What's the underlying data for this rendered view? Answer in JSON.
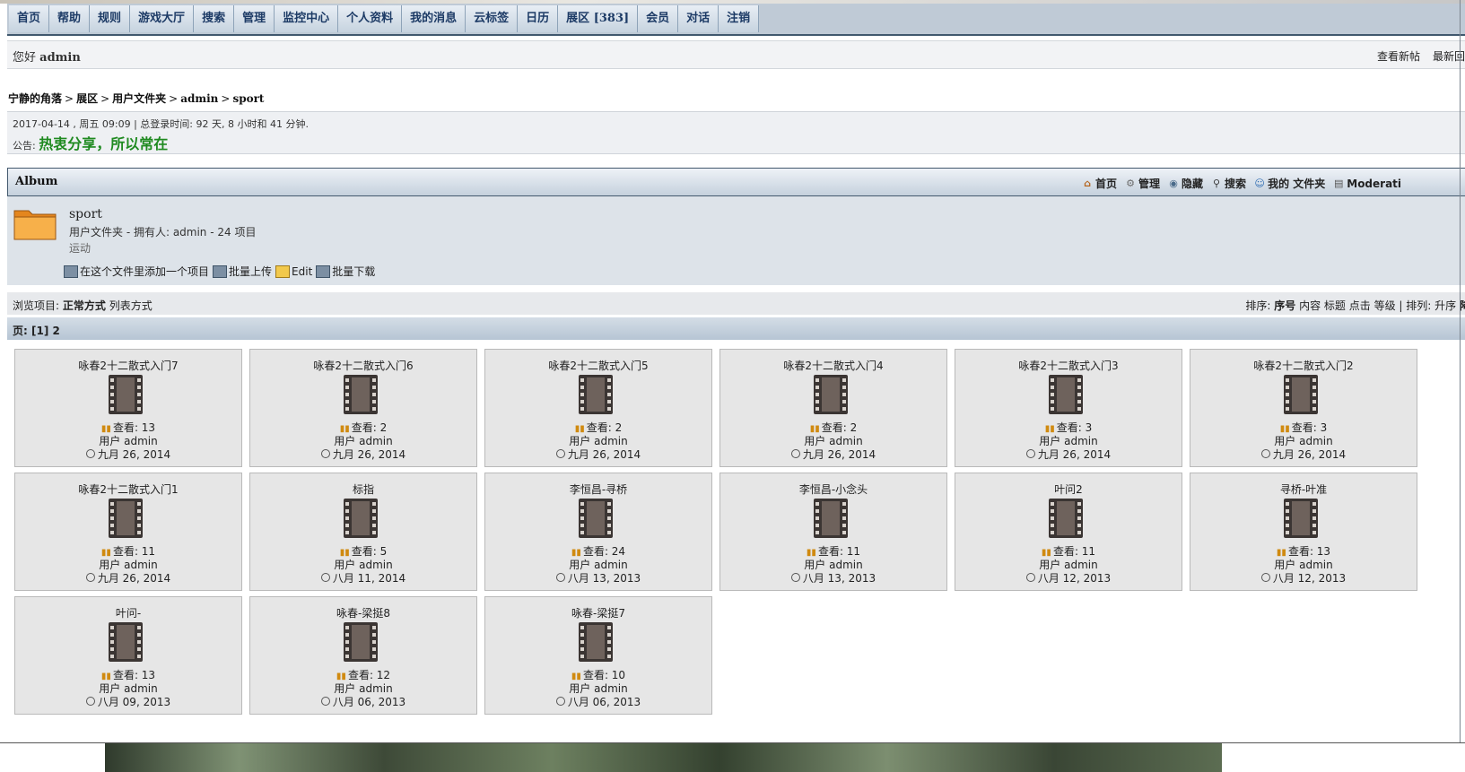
{
  "nav": [
    "首页",
    "帮助",
    "规则",
    "游戏大厅",
    "搜索",
    "管理",
    "监控中心",
    "个人资料",
    "我的消息",
    "云标签",
    "日历",
    "展区 [383]",
    "会员",
    "对话",
    "注销"
  ],
  "greeting": {
    "prefix": "您好 ",
    "user": "admin",
    "links": [
      "查看新帖",
      "最新回"
    ]
  },
  "breadcrumb": [
    "宁静的角落",
    "展区",
    "用户文件夹",
    "admin",
    "sport"
  ],
  "info": {
    "line": "2017-04-14 , 周五 09:09 | 总登录时间: 92 天, 8 小时和 41 分钟.",
    "notice_label": "公告: ",
    "notice": "热衷分享，所以常在"
  },
  "album": {
    "title": "Album",
    "tools": [
      {
        "label": "首页",
        "icon": "home-icon"
      },
      {
        "label": "管理",
        "icon": "gear-icon"
      },
      {
        "label": "隐藏",
        "icon": "eye-icon"
      },
      {
        "label": "搜索",
        "icon": "search-icon"
      },
      {
        "label": "我的 文件夹",
        "icon": "user-icon"
      },
      {
        "label": "Moderati",
        "icon": "page-icon"
      }
    ]
  },
  "folder": {
    "name": "sport",
    "meta": "用户文件夹 - 拥有人: admin - 24 项目",
    "desc": "运动",
    "actions": [
      "在这个文件里添加一个项目",
      "批量上传",
      "Edit",
      "批量下载"
    ]
  },
  "view": {
    "label": "浏览项目: ",
    "current": "正常方式",
    "alt": "列表方式"
  },
  "sort": {
    "label": "排序: ",
    "options": [
      "序号",
      "内容",
      "标题",
      "点击",
      "等级"
    ],
    "order_label": " | 排列: ",
    "orders": [
      "升序",
      "降"
    ]
  },
  "pager": {
    "label": "页: ",
    "pages": [
      "[1]",
      "2"
    ]
  },
  "items": [
    {
      "title": "咏春2十二散式入门7",
      "views": "查看: 13",
      "user": "用户 admin",
      "date": "九月 26, 2014"
    },
    {
      "title": "咏春2十二散式入门6",
      "views": "查看: 2",
      "user": "用户 admin",
      "date": "九月 26, 2014"
    },
    {
      "title": "咏春2十二散式入门5",
      "views": "查看: 2",
      "user": "用户 admin",
      "date": "九月 26, 2014"
    },
    {
      "title": "咏春2十二散式入门4",
      "views": "查看: 2",
      "user": "用户 admin",
      "date": "九月 26, 2014"
    },
    {
      "title": "咏春2十二散式入门3",
      "views": "查看: 3",
      "user": "用户 admin",
      "date": "九月 26, 2014"
    },
    {
      "title": "咏春2十二散式入门2",
      "views": "查看: 3",
      "user": "用户 admin",
      "date": "九月 26, 2014"
    },
    {
      "title": "咏春2十二散式入门1",
      "views": "查看: 11",
      "user": "用户 admin",
      "date": "九月 26, 2014"
    },
    {
      "title": "标指",
      "views": "查看: 5",
      "user": "用户 admin",
      "date": "八月 11, 2014"
    },
    {
      "title": "李恒昌-寻桥",
      "views": "查看: 24",
      "user": "用户 admin",
      "date": "八月 13, 2013"
    },
    {
      "title": "李恒昌-小念头",
      "views": "查看: 11",
      "user": "用户 admin",
      "date": "八月 13, 2013"
    },
    {
      "title": "叶问2",
      "views": "查看: 11",
      "user": "用户 admin",
      "date": "八月 12, 2013"
    },
    {
      "title": "寻桥-叶准",
      "views": "查看: 13",
      "user": "用户 admin",
      "date": "八月 12, 2013"
    },
    {
      "title": "叶问-",
      "views": "查看: 13",
      "user": "用户 admin",
      "date": "八月 09, 2013"
    },
    {
      "title": "咏春-梁挺8",
      "views": "查看: 12",
      "user": "用户 admin",
      "date": "八月 06, 2013"
    },
    {
      "title": "咏春-梁挺7",
      "views": "查看: 10",
      "user": "用户 admin",
      "date": "八月 06, 2013"
    }
  ]
}
